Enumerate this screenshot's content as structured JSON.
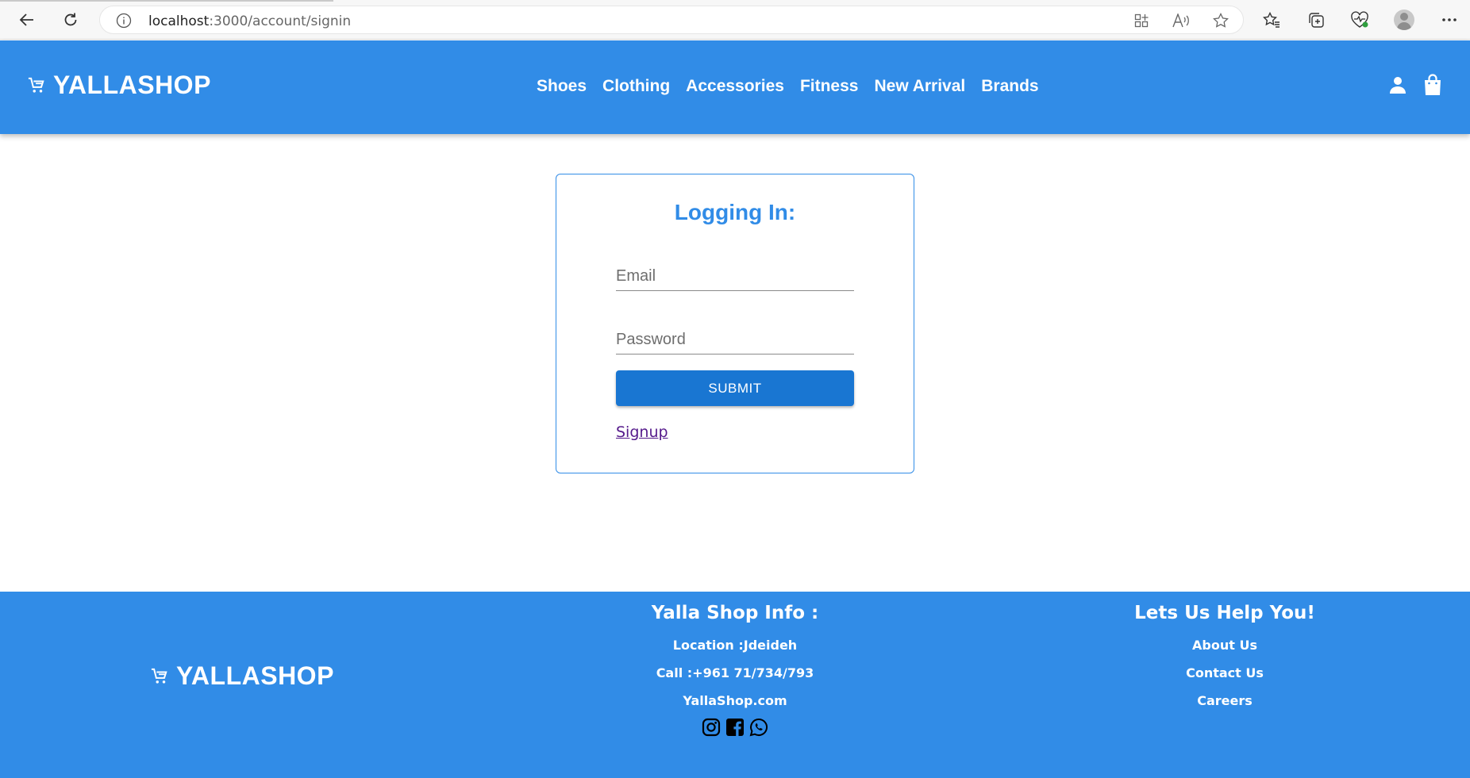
{
  "browser": {
    "url_host": "localhost",
    "url_path": ":3000/account/signin"
  },
  "header": {
    "brand": "YALLASHOP",
    "nav": [
      "Shoes",
      "Clothing",
      "Accessories",
      "Fitness",
      "New Arrival",
      "Brands"
    ],
    "icons": [
      "cart-icon",
      "user-icon",
      "shopping-bag-icon"
    ]
  },
  "login": {
    "title": "Logging In:",
    "email_placeholder": "Email",
    "password_placeholder": "Password",
    "submit_label": "SUBMIT",
    "signup_label": "Signup"
  },
  "footer": {
    "brand": "YALLASHOP",
    "info_title": "Yalla Shop Info :",
    "location": "Location :Jdeideh",
    "call": "Call :+961 71/734/793",
    "website": "YallaShop.com",
    "social_icons": [
      "instagram-icon",
      "facebook-icon",
      "whatsapp-icon"
    ],
    "help_title": "Lets Us Help You!",
    "links": [
      "About Us",
      "Contact Us",
      "Careers"
    ]
  },
  "colors": {
    "brand_blue": "#318ce7",
    "button_blue": "#1976d2",
    "visited_link": "#551a8b"
  }
}
